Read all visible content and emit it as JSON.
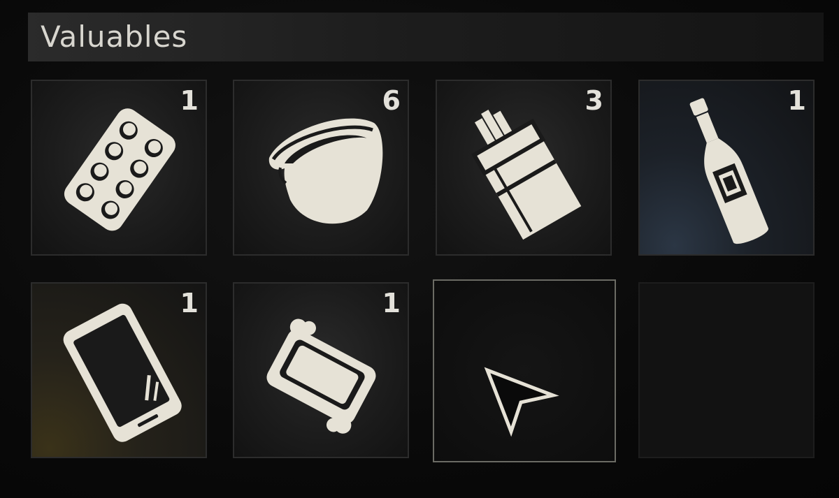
{
  "panel": {
    "title": "Valuables"
  },
  "colors": {
    "icon_fill": "#e6e2d6",
    "icon_dark": "#1a1a1a",
    "text": "#e3e1da",
    "selected_border": "#6b6b64"
  },
  "slots": [
    {
      "item": "pill-blister-pack",
      "icon": "pills-icon",
      "quantity": "1"
    },
    {
      "item": "bracelet",
      "icon": "bracelet-icon",
      "quantity": "6"
    },
    {
      "item": "cigarette-pack",
      "icon": "cigarettes-icon",
      "quantity": "3"
    },
    {
      "item": "bottle",
      "icon": "bottle-icon",
      "quantity": "1"
    },
    {
      "item": "smartphone",
      "icon": "phone-icon",
      "quantity": "1"
    },
    {
      "item": "soap-bar",
      "icon": "soap-icon",
      "quantity": "1"
    },
    {
      "item": "empty",
      "icon": "pointer-cursor-icon",
      "quantity": ""
    },
    {
      "item": "empty",
      "icon": "",
      "quantity": ""
    }
  ]
}
